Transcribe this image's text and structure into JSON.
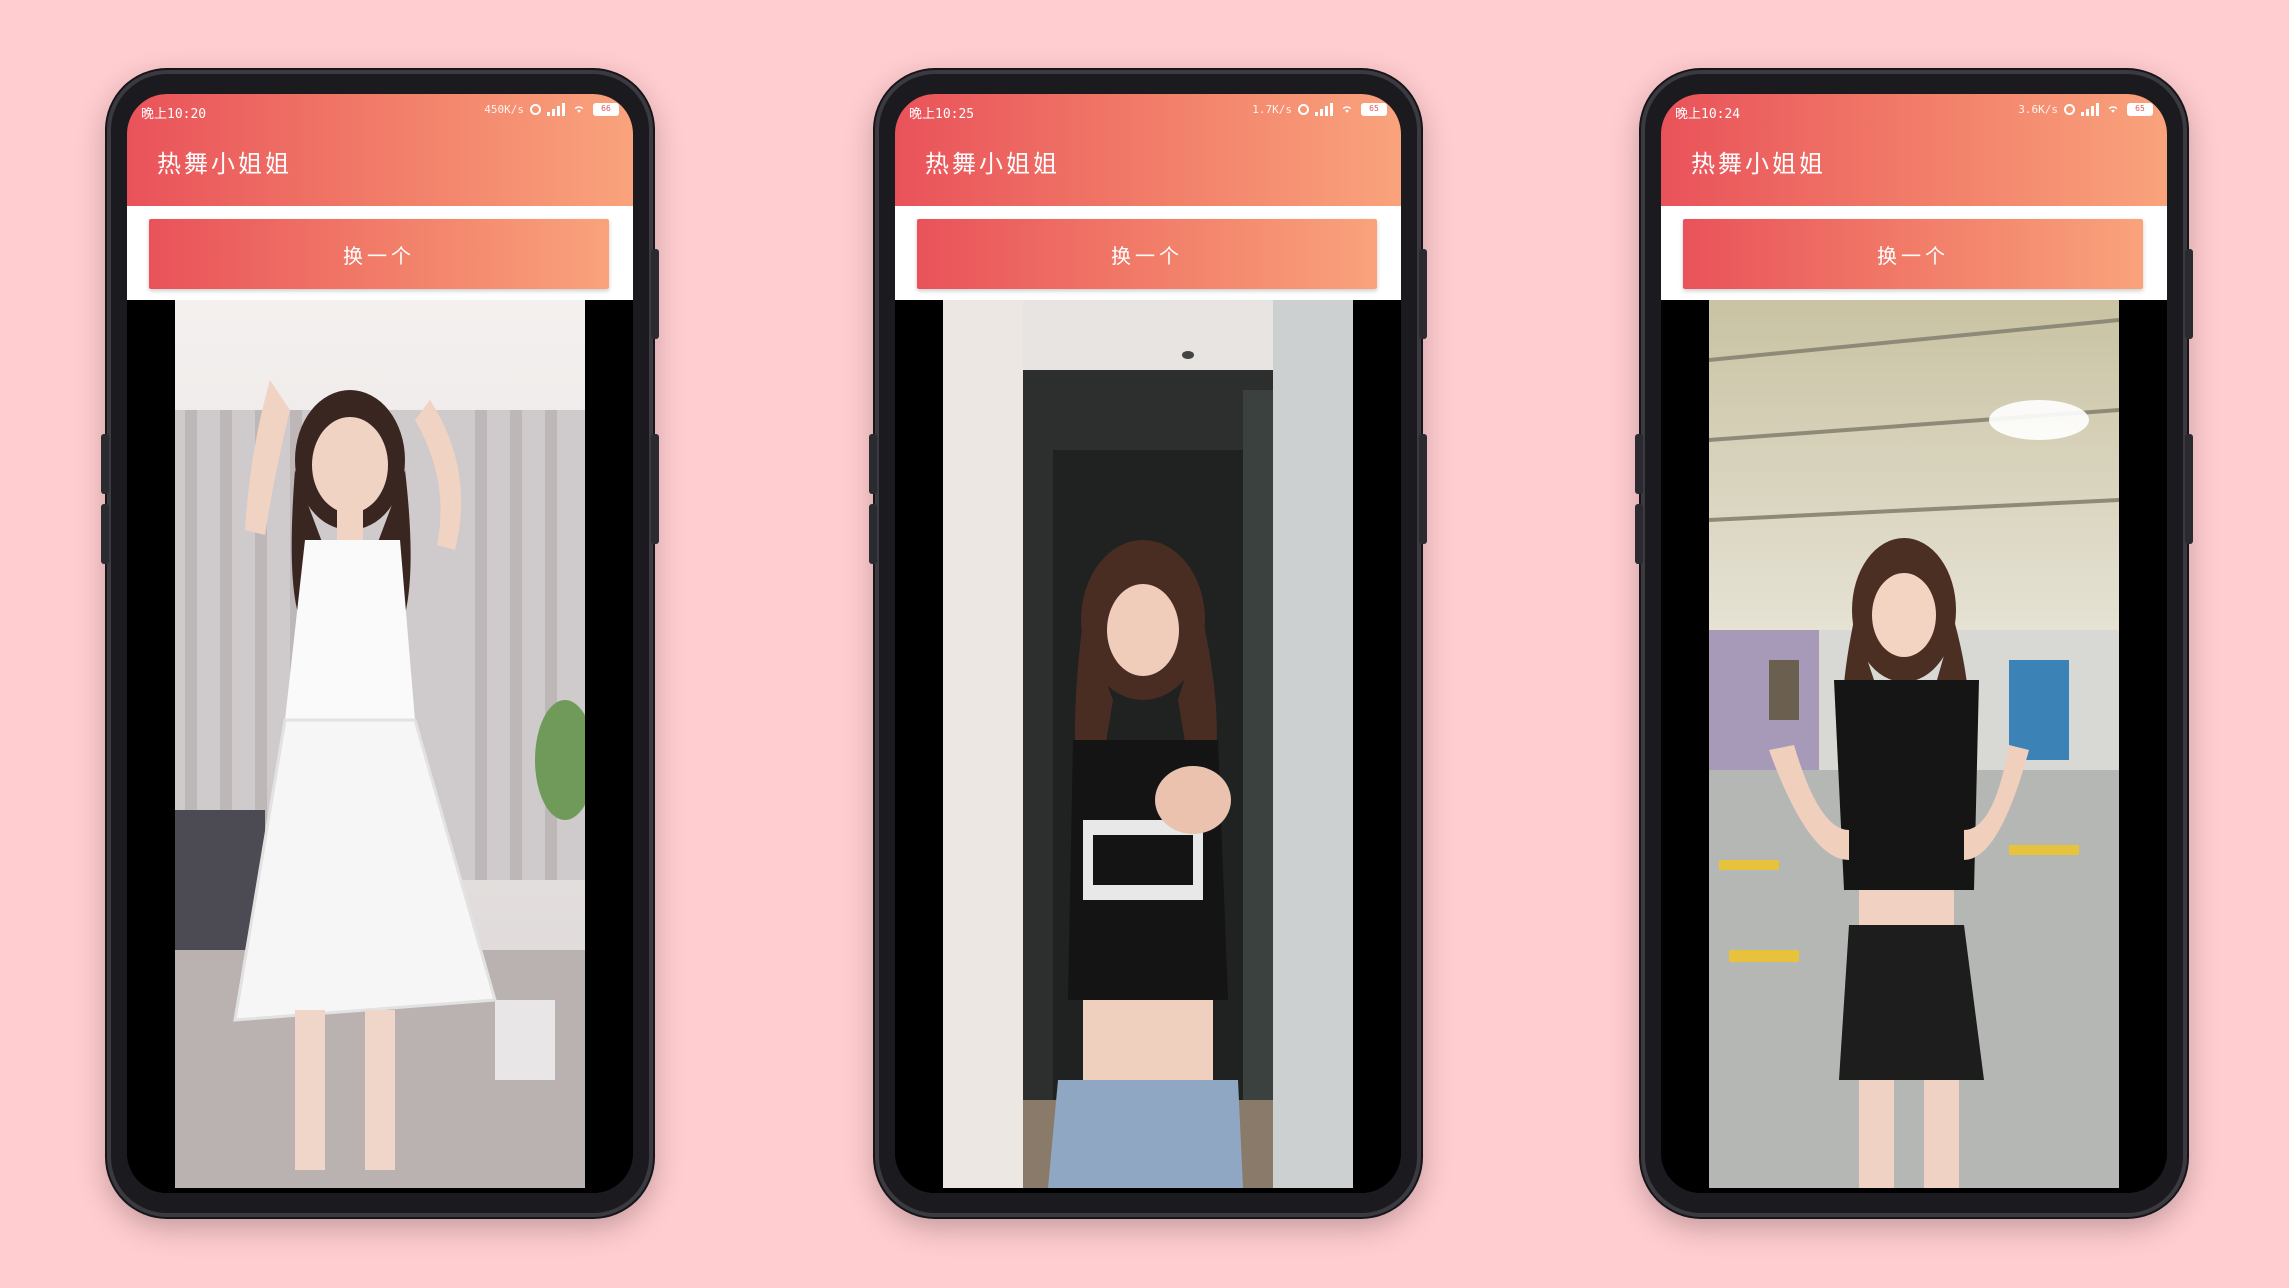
{
  "page": {
    "background_color": "#ffcccf",
    "accent_gradient": [
      "#e9525a",
      "#f9a37c"
    ]
  },
  "screens": [
    {
      "status": {
        "time": "晚上10:20",
        "net_speed": "450K/s",
        "battery": "66"
      },
      "app_title": "热舞小姐姐",
      "button_label": "换一个",
      "video_scene": "dancer-white-dress-bedroom"
    },
    {
      "status": {
        "time": "晚上10:25",
        "net_speed": "1.7K/s",
        "battery": "65"
      },
      "app_title": "热舞小姐姐",
      "button_label": "换一个",
      "video_scene": "dancer-black-crop-top-hallway"
    },
    {
      "status": {
        "time": "晚上10:24",
        "net_speed": "3.6K/s",
        "battery": "65"
      },
      "app_title": "热舞小姐姐",
      "button_label": "换一个",
      "video_scene": "dancer-black-top-parking-garage"
    }
  ]
}
